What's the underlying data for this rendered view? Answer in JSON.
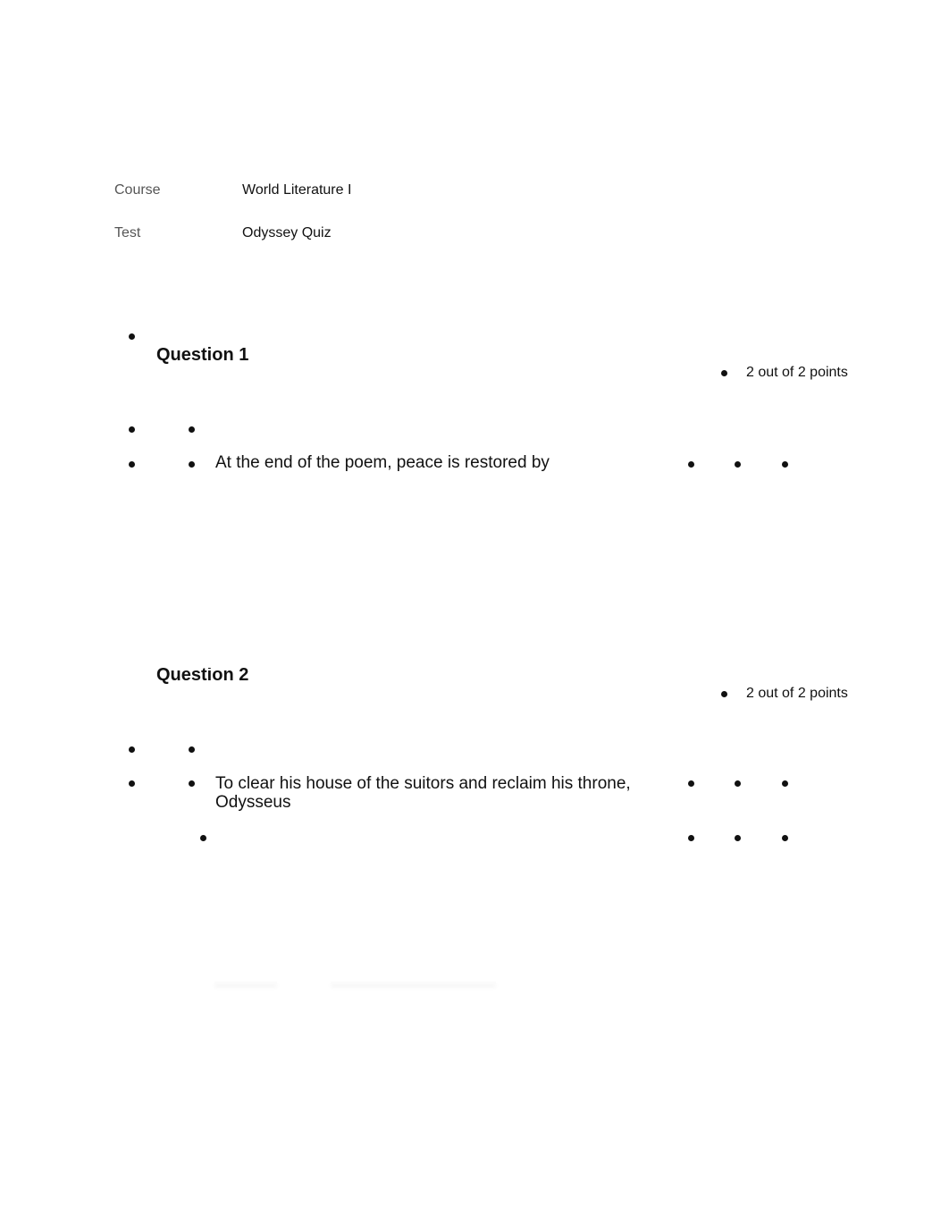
{
  "meta": {
    "course_label": "Course",
    "course_value": "World Literature I",
    "test_label": "Test",
    "test_value": "Odyssey Quiz"
  },
  "questions": [
    {
      "heading": "Question 1",
      "points": "2 out of 2 points",
      "text": "At the end of the poem, peace is restored by"
    },
    {
      "heading": "Question 2",
      "points": "2 out of 2 points",
      "text": "To clear his house of the suitors and reclaim his throne, Odysseus"
    }
  ],
  "icons": {
    "bullet": "disc-bullet-icon"
  }
}
